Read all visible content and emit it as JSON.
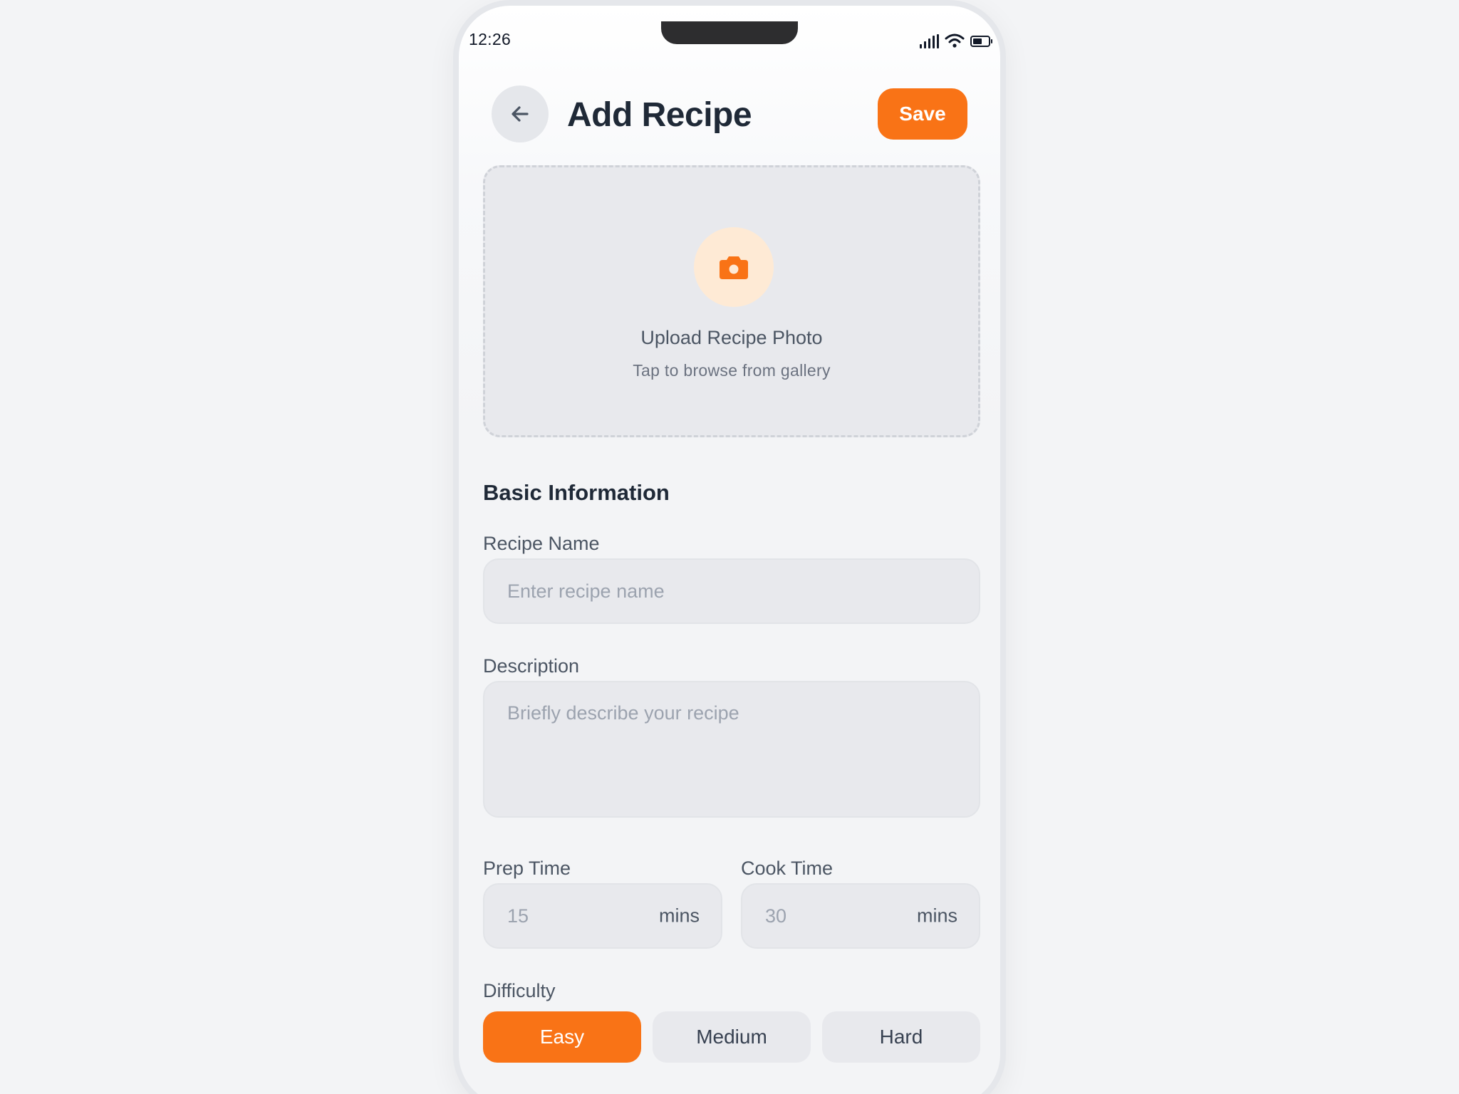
{
  "status_bar": {
    "time": "12:26"
  },
  "header": {
    "title": "Add Recipe",
    "save_label": "Save"
  },
  "upload": {
    "title": "Upload Recipe Photo",
    "subtitle": "Tap to browse from gallery"
  },
  "basic_info": {
    "heading": "Basic Information",
    "recipe_name": {
      "label": "Recipe Name",
      "placeholder": "Enter recipe name"
    },
    "description": {
      "label": "Description",
      "placeholder": "Briefly describe your recipe"
    },
    "prep_time": {
      "label": "Prep Time",
      "placeholder": "15",
      "unit": "mins"
    },
    "cook_time": {
      "label": "Cook Time",
      "placeholder": "30",
      "unit": "mins"
    }
  },
  "difficulty": {
    "label": "Difficulty",
    "options": [
      "Easy",
      "Medium",
      "Hard"
    ],
    "selected": "Easy"
  },
  "colors": {
    "accent": "#f97316",
    "accent_light": "#feead5",
    "title": "#1f2937",
    "input_bg": "#e8e9ed"
  },
  "icons": [
    "back-arrow-icon",
    "camera-icon",
    "signal-icon",
    "wifi-icon",
    "battery-icon"
  ]
}
